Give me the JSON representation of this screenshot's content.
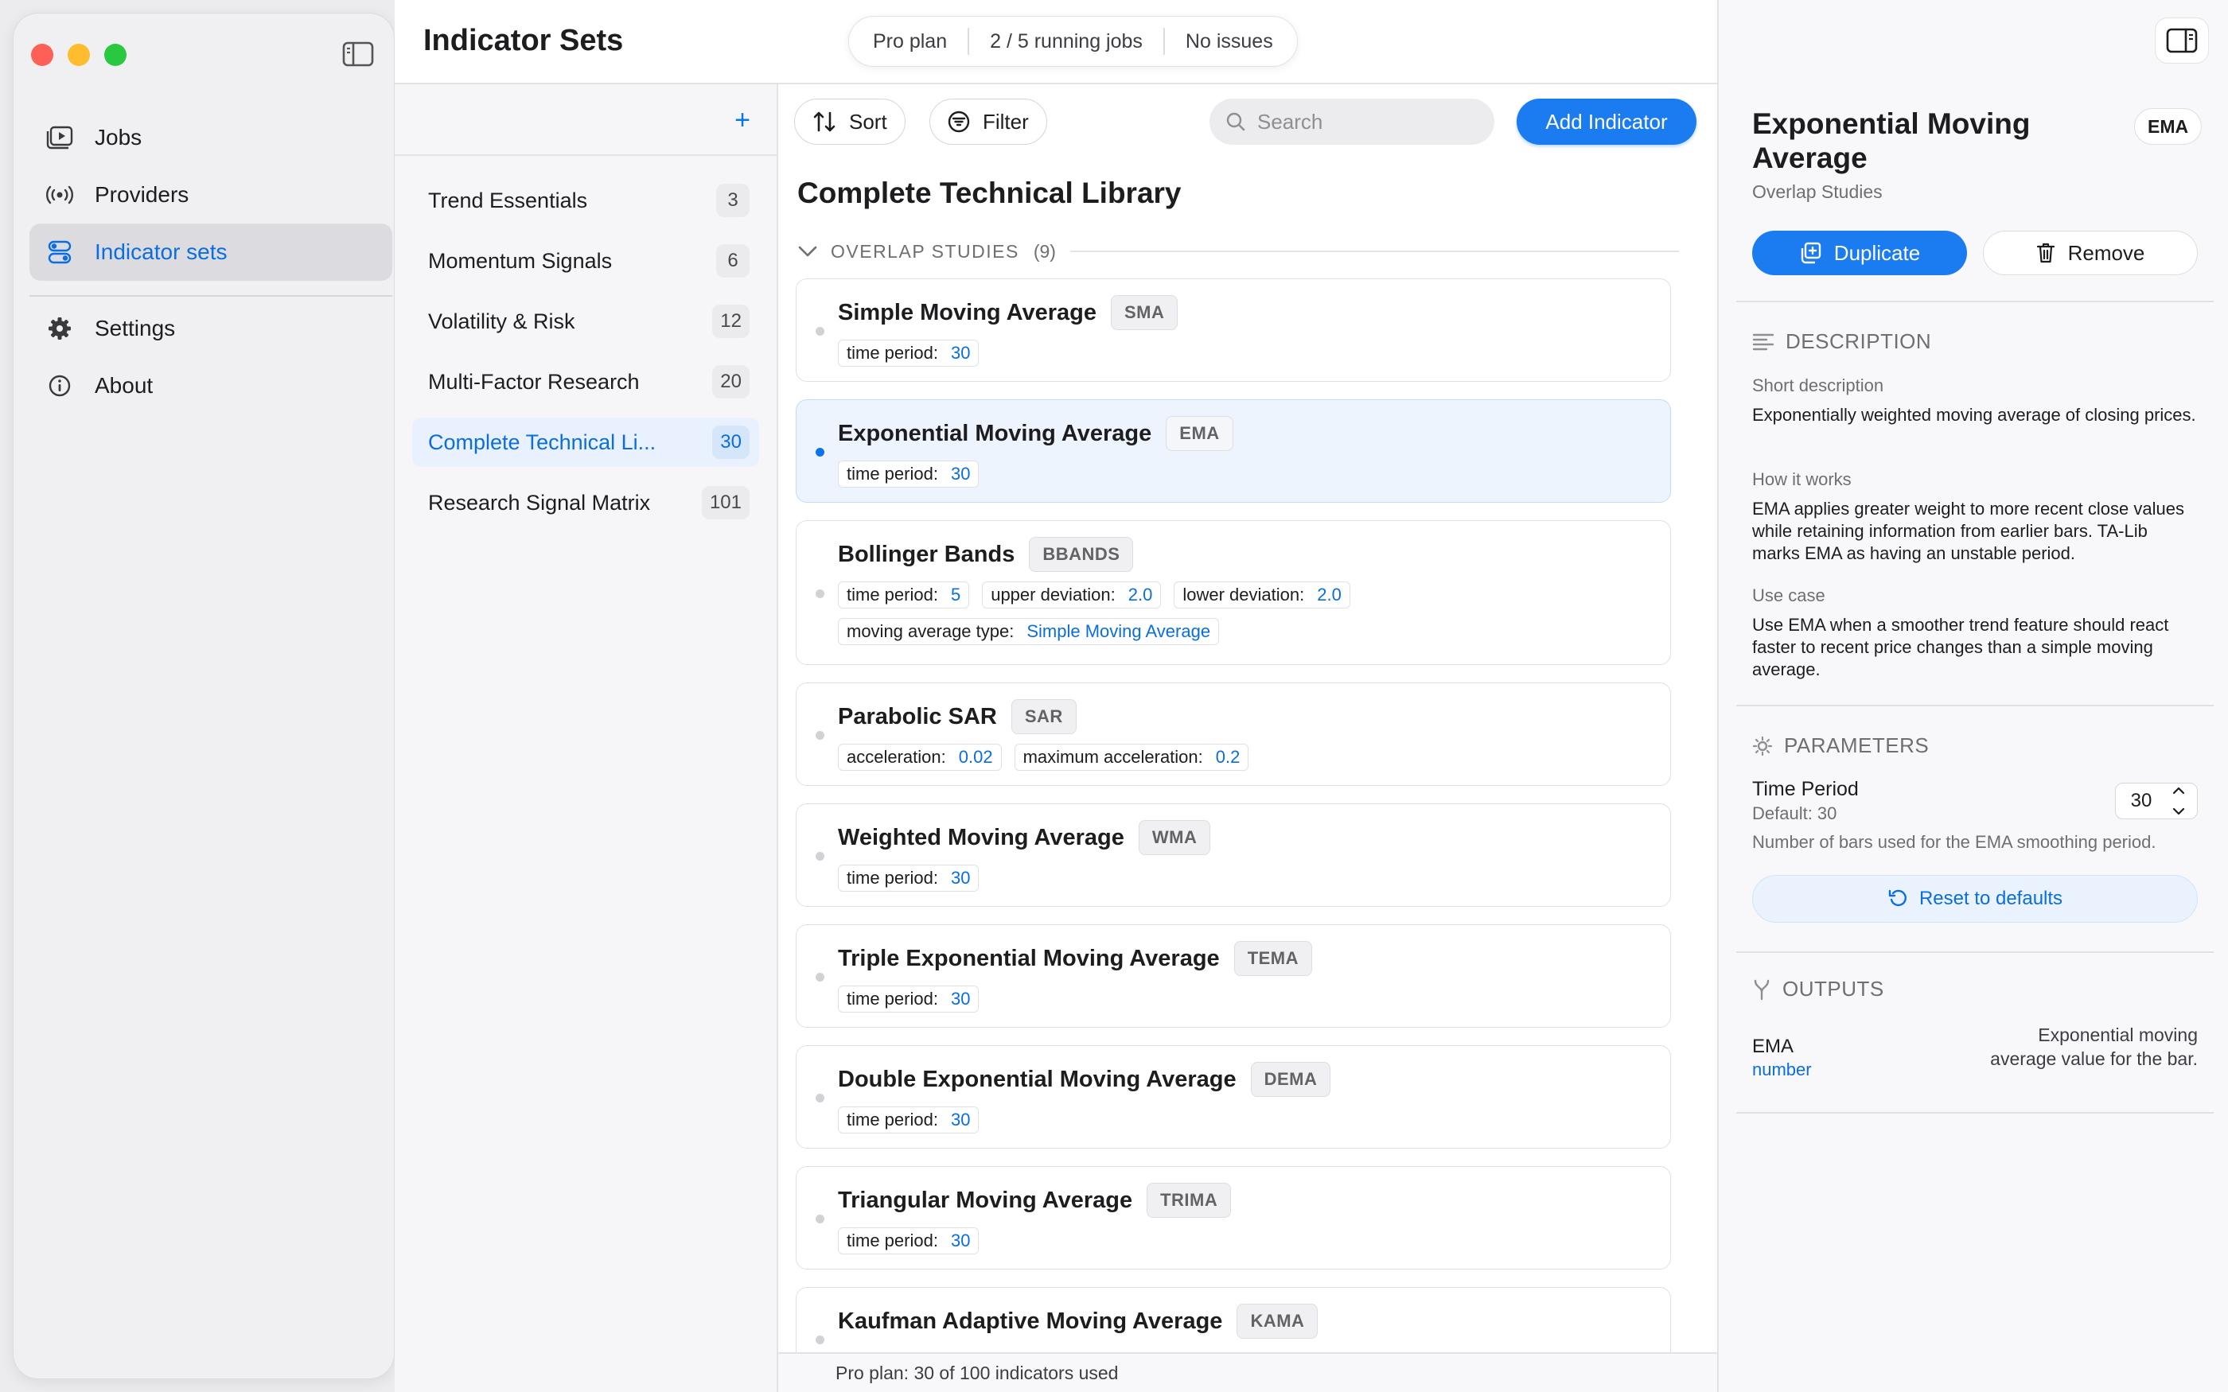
{
  "sidebar": {
    "items": [
      {
        "label": "Jobs",
        "icon": "jobs-icon"
      },
      {
        "label": "Providers",
        "icon": "broadcast-icon"
      },
      {
        "label": "Indicator sets",
        "icon": "toggles-icon",
        "active": true
      },
      {
        "label": "Settings",
        "icon": "gear-icon"
      },
      {
        "label": "About",
        "icon": "info-icon"
      }
    ]
  },
  "header": {
    "title": "Indicator Sets",
    "status": {
      "plan": "Pro plan",
      "jobs": "2 / 5 running jobs",
      "issues": "No issues"
    }
  },
  "sets": [
    {
      "name": "Trend Essentials",
      "count": "3"
    },
    {
      "name": "Momentum Signals",
      "count": "6"
    },
    {
      "name": "Volatility & Risk",
      "count": "12"
    },
    {
      "name": "Multi-Factor Research",
      "count": "20"
    },
    {
      "name": "Complete Technical Li...",
      "count": "30",
      "active": true
    },
    {
      "name": "Research Signal Matrix",
      "count": "101"
    }
  ],
  "toolbar": {
    "sort_label": "Sort",
    "filter_label": "Filter",
    "search_placeholder": "Search",
    "add_label": "Add Indicator"
  },
  "library": {
    "title": "Complete Technical Library",
    "group": {
      "name": "OVERLAP STUDIES",
      "count": "(9)"
    },
    "indicators": [
      {
        "name": "Simple Moving Average",
        "abbr": "SMA",
        "params": [
          {
            "label": "time period:",
            "value": "30"
          }
        ]
      },
      {
        "name": "Exponential Moving Average",
        "abbr": "EMA",
        "selected": true,
        "params": [
          {
            "label": "time period:",
            "value": "30"
          }
        ]
      },
      {
        "name": "Bollinger Bands",
        "abbr": "BBANDS",
        "params": [
          {
            "label": "time period:",
            "value": "5"
          },
          {
            "label": "upper deviation:",
            "value": "2.0"
          },
          {
            "label": "lower deviation:",
            "value": "2.0"
          },
          {
            "label": "moving average type:",
            "value": "Simple Moving Average"
          }
        ]
      },
      {
        "name": "Parabolic SAR",
        "abbr": "SAR",
        "params": [
          {
            "label": "acceleration:",
            "value": "0.02"
          },
          {
            "label": "maximum acceleration:",
            "value": "0.2"
          }
        ]
      },
      {
        "name": "Weighted Moving Average",
        "abbr": "WMA",
        "params": [
          {
            "label": "time period:",
            "value": "30"
          }
        ]
      },
      {
        "name": "Triple Exponential Moving Average",
        "abbr": "TEMA",
        "params": [
          {
            "label": "time period:",
            "value": "30"
          }
        ]
      },
      {
        "name": "Double Exponential Moving Average",
        "abbr": "DEMA",
        "params": [
          {
            "label": "time period:",
            "value": "30"
          }
        ]
      },
      {
        "name": "Triangular Moving Average",
        "abbr": "TRIMA",
        "params": [
          {
            "label": "time period:",
            "value": "30"
          }
        ]
      },
      {
        "name": "Kaufman Adaptive Moving Average",
        "abbr": "KAMA",
        "params": []
      }
    ]
  },
  "footer": {
    "text": "Pro plan: 30 of 100 indicators used"
  },
  "inspector": {
    "title": "Exponential Moving Average",
    "abbr": "EMA",
    "category": "Overlap Studies",
    "duplicate_label": "Duplicate",
    "remove_label": "Remove",
    "description": {
      "heading": "DESCRIPTION",
      "short_label": "Short description",
      "short_text": "Exponentially weighted moving average of closing prices.",
      "how_label": "How it works",
      "how_text": "EMA applies greater weight to more recent close values while retaining information from earlier bars. TA-Lib marks EMA as having an unstable period.",
      "use_label": "Use case",
      "use_text": "Use EMA when a smoother trend feature should react faster to recent price changes than a simple moving average."
    },
    "parameters": {
      "heading": "PARAMETERS",
      "name": "Time Period",
      "default": "Default: 30",
      "value": "30",
      "help": "Number of bars used for the EMA smoothing period.",
      "reset_label": "Reset to defaults"
    },
    "outputs": {
      "heading": "OUTPUTS",
      "name": "EMA",
      "type": "number",
      "description": "Exponential moving average value for the bar."
    }
  },
  "colors": {
    "accent": "#1a7cf0",
    "selected_bg": "#edf4fe",
    "sidebar_active_bg": "#dcdce0"
  }
}
